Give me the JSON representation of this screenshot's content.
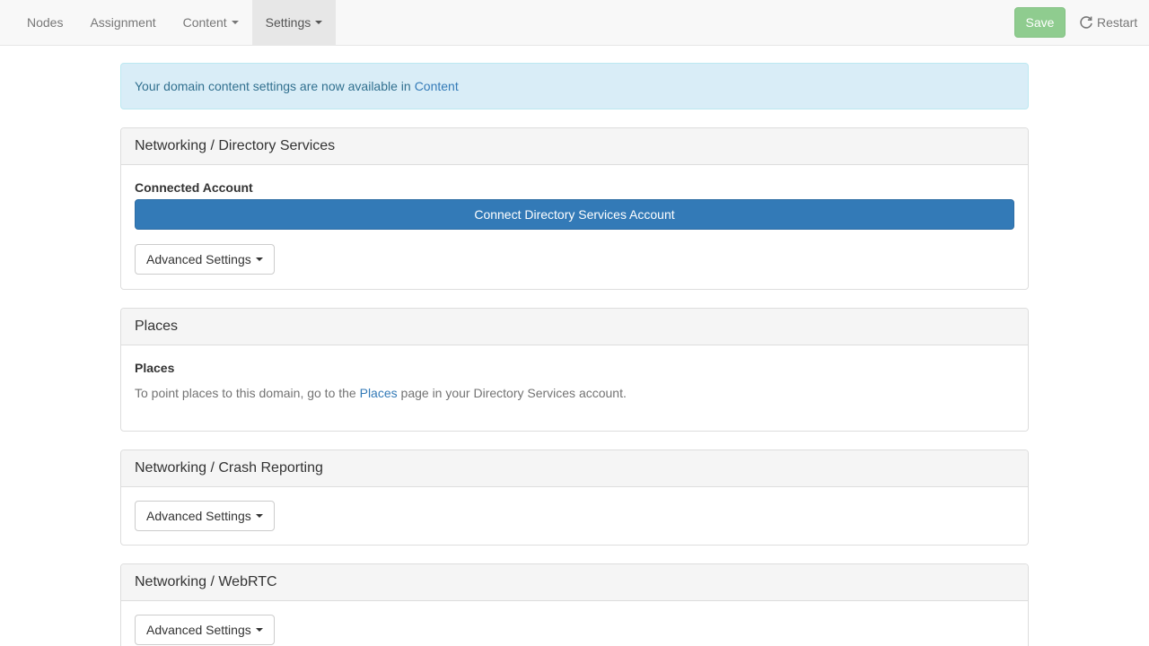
{
  "navbar": {
    "items": [
      {
        "label": "Nodes"
      },
      {
        "label": "Assignment"
      },
      {
        "label": "Content"
      },
      {
        "label": "Settings"
      }
    ],
    "save_label": "Save",
    "restart_label": "Restart"
  },
  "alert": {
    "text": "Your domain content settings are now available in",
    "link": "Content"
  },
  "panels": {
    "directory": {
      "title": "Networking / Directory Services",
      "account_label": "Connected Account",
      "connect_label": "Connect Directory Services Account",
      "advanced_label": "Advanced Settings"
    },
    "places": {
      "title": "Places",
      "subtitle": "Places",
      "text_before": "To point places to this domain, go to the",
      "link": "Places",
      "text_after": "page in your Directory Services account."
    },
    "crash": {
      "title": "Networking / Crash Reporting",
      "advanced_label": "Advanced Settings"
    },
    "webrtc": {
      "title": "Networking / WebRTC",
      "advanced_label": "Advanced Settings"
    }
  },
  "colors": {
    "primary": "#337ab7",
    "success_disabled": "#8fcc8f",
    "info_bg": "#d9edf7"
  }
}
